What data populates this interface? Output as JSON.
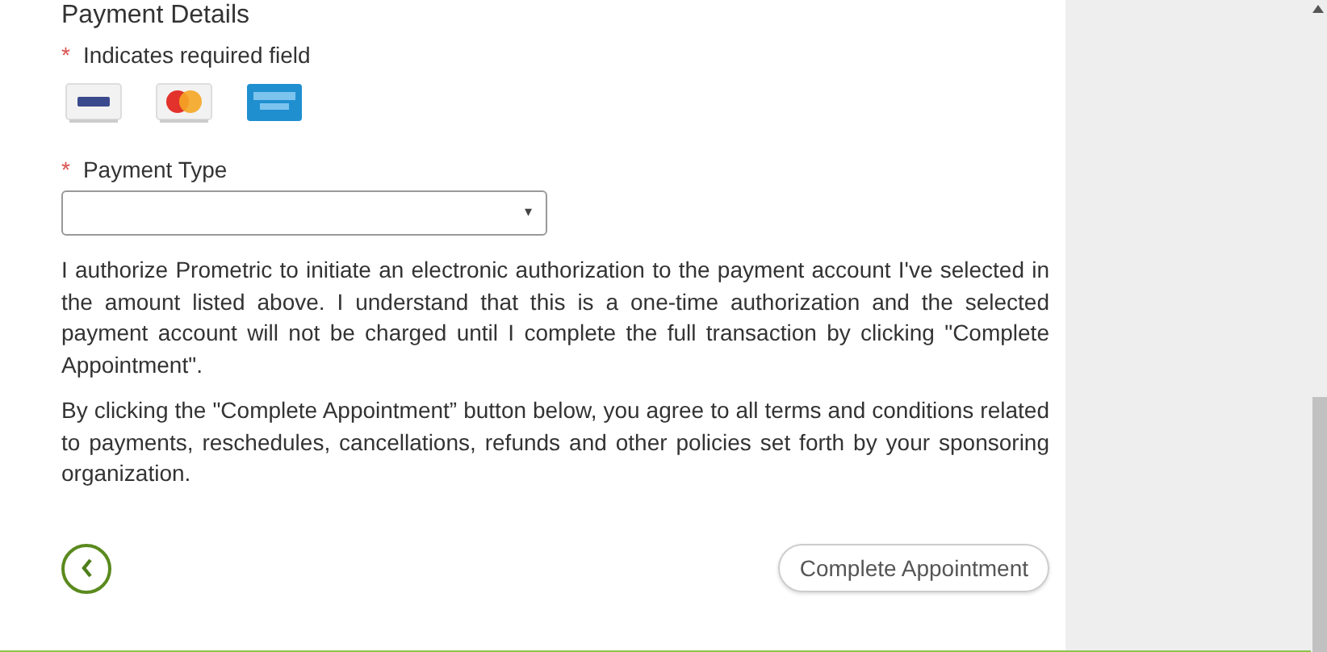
{
  "section_title": "Payment Details",
  "required_note": {
    "mark": "*",
    "text": "Indicates required field"
  },
  "cards": [
    {
      "kind": "visa"
    },
    {
      "kind": "mastercard"
    },
    {
      "kind": "amex"
    }
  ],
  "payment_type": {
    "mark": "*",
    "label": "Payment Type",
    "arrow": "▾"
  },
  "paragraphs": [
    "I authorize Prometric to initiate an electronic authorization to the payment account I've selected in the amount listed above. I understand that this is a one-time authorization and the selected payment account will not be charged until I complete the full transaction by clicking \"Complete Appointment\".",
    "By clicking the \"Complete Appointment” button below, you agree to all terms and conditions related to payments, reschedules, cancellations, refunds and other policies set forth by your sponsoring organization."
  ],
  "complete_button": "Complete Appointment"
}
